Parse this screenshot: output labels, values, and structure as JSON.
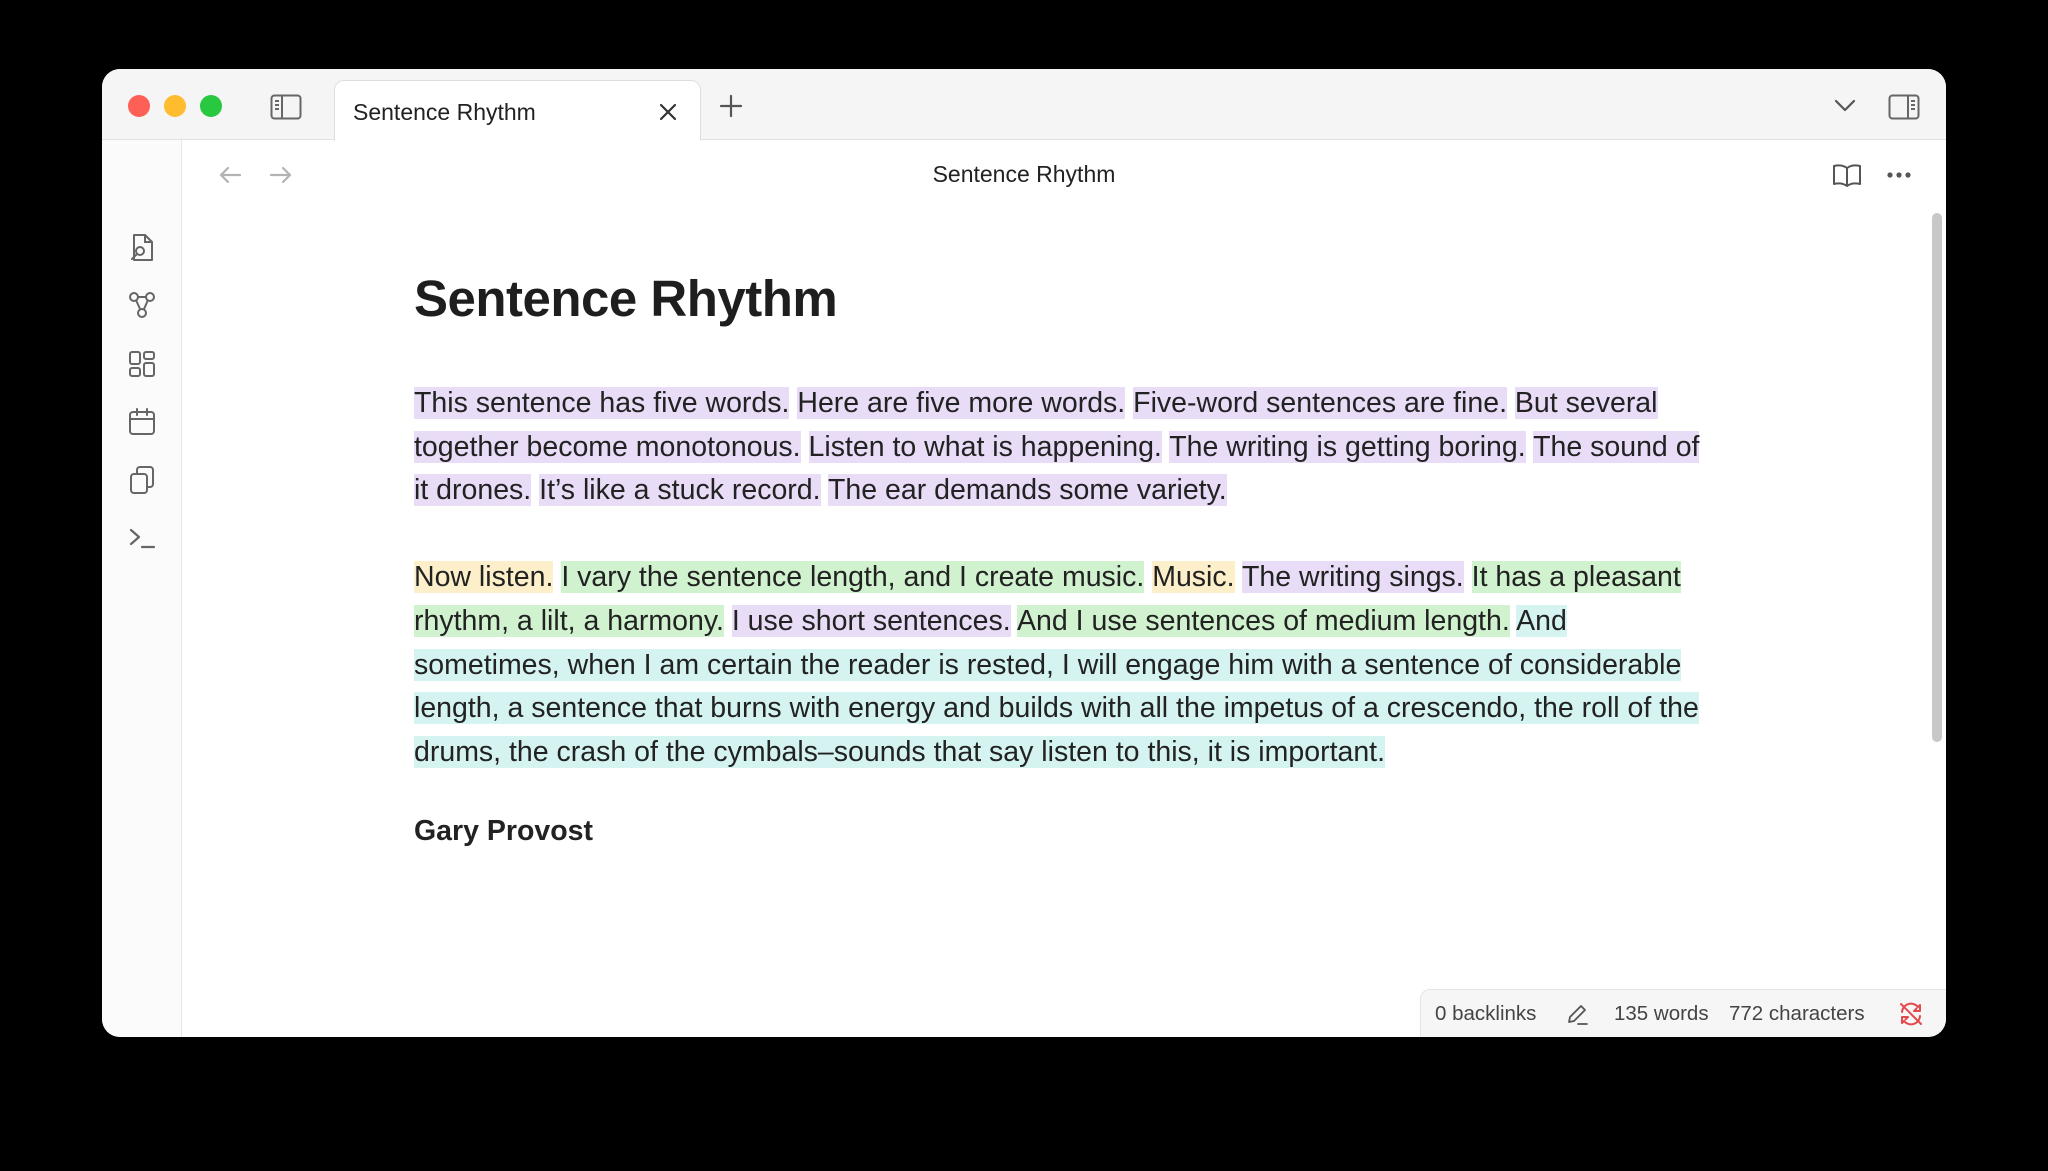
{
  "app": {
    "tab_title": "Sentence Rhythm",
    "header_title": "Sentence Rhythm"
  },
  "ribbon": {
    "icons": [
      "file-search-icon",
      "graph-icon",
      "canvas-icon",
      "calendar-icon",
      "copy-icon",
      "terminal-icon"
    ]
  },
  "note": {
    "title": "Sentence Rhythm",
    "paragraph1": [
      {
        "text": "This sentence has five words.",
        "color": "#e8dcf7"
      },
      {
        "text": "Here are five more words.",
        "color": "#e8dcf7"
      },
      {
        "text": "Five-word sentences are fine.",
        "color": "#e8dcf7"
      },
      {
        "text": "But several together become monotonous.",
        "color": "#e8dcf7"
      },
      {
        "text": "Listen to what is happening.",
        "color": "#e8dcf7"
      },
      {
        "text": "The writing is getting boring.",
        "color": "#e8dcf7"
      },
      {
        "text": "The sound of it drones.",
        "color": "#e8dcf7"
      },
      {
        "text": "It’s like a stuck record.",
        "color": "#e8dcf7"
      },
      {
        "text": "The ear demands some variety.",
        "color": "#e8dcf7"
      }
    ],
    "paragraph2": [
      {
        "text": "Now listen.",
        "color": "#fcefc9"
      },
      {
        "text": "I vary the sentence length, and I create music.",
        "color": "#d1f2cf"
      },
      {
        "text": "Music.",
        "color": "#fcefc9"
      },
      {
        "text": "The writing sings.",
        "color": "#e8dcf7"
      },
      {
        "text": "It has a pleasant rhythm, a lilt, a harmony.",
        "color": "#d1f2cf"
      },
      {
        "text": "I use short sentences.",
        "color": "#e8dcf7"
      },
      {
        "text": "And I use sentences of medium length.",
        "color": "#d1f2cf"
      },
      {
        "text": "And sometimes, when I am certain the reader is rested, I will engage him with a sentence of considerable length, a sentence that burns with energy and builds with all the impetus of a crescendo, the roll of the drums, the crash of the cymbals–sounds that say listen to this, it is important.",
        "color": "#d5f4f1"
      }
    ],
    "author": "Gary Provost"
  },
  "status": {
    "backlinks": "0 backlinks",
    "words": "135 words",
    "characters": "772 characters"
  },
  "colors": {
    "purple": "#e8dcf7",
    "yellow": "#fcefc9",
    "green": "#d1f2cf",
    "cyan": "#d5f4f1",
    "sync_error": "#e5484d"
  }
}
